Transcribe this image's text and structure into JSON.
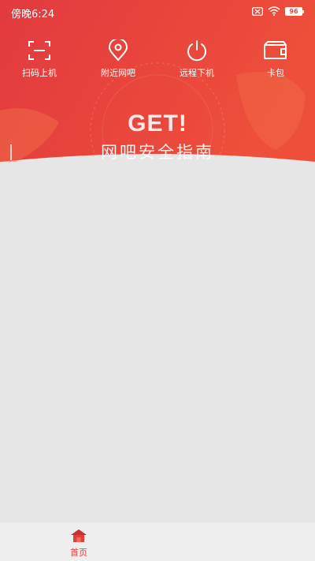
{
  "status_bar": {
    "time": "傍晚6:24",
    "battery": "96"
  },
  "actions": [
    {
      "label": "扫码上机",
      "icon": "scan-icon"
    },
    {
      "label": "附近网吧",
      "icon": "location-pin-icon"
    },
    {
      "label": "远程下机",
      "icon": "power-icon"
    },
    {
      "label": "卡包",
      "icon": "wallet-icon"
    }
  ],
  "banner": {
    "title": "GET!",
    "subtitle": "网吧安全指南"
  },
  "tab_bar": {
    "home_label": "首页"
  },
  "colors": {
    "header_red": "#e8463c",
    "header_red_dark": "#e23a3f",
    "background": "#e6e6e6",
    "tab_active": "#e0403a"
  }
}
